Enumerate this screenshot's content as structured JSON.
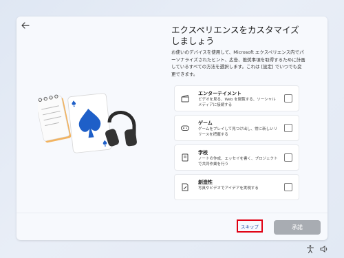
{
  "page": {
    "title": "エクスペリエンスをカスタマイズしましょう",
    "description": "お使いのデバイスを使用して、Microsoft エクスペリエンス内でパーソナライズされたヒント、広告、推奨事項を取得するために計画しているすべての方法を選択します。これは [設定] でいつでも変更できます。"
  },
  "options": [
    {
      "icon": "clapperboard-icon",
      "name": "エンターテイメント",
      "desc": "ビデオを見る、Web を閲覧する、ソーシャル メディアに接続する",
      "checked": false
    },
    {
      "icon": "gamepad-icon",
      "name": "ゲーム",
      "desc": "ゲームをプレイして見つけ出し、常に新しいリリースを把握する",
      "checked": false
    },
    {
      "icon": "notebook-icon",
      "name": "学校",
      "desc": "ノートの作成、エッセイを書く、プロジェクトで共同作業を行う",
      "checked": false
    },
    {
      "icon": "pencil-paper-icon",
      "name": "創造性",
      "desc": "写真やビデオでアイデアを実現する",
      "checked": false
    }
  ],
  "buttons": {
    "skip": "スキップ",
    "accept": "承諾"
  },
  "colors": {
    "highlight": "#e00012",
    "link": "#1d47a8",
    "button_disabled": "#a8acb2"
  }
}
